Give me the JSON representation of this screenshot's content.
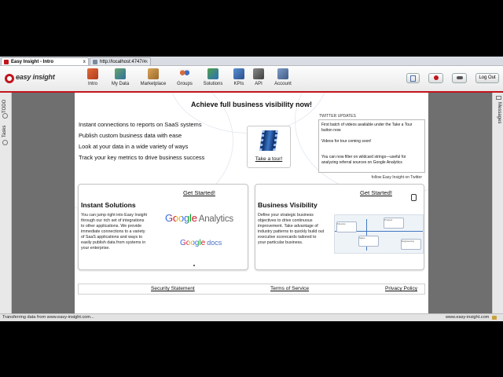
{
  "tabs": [
    {
      "label": "Easy Insight - Intro",
      "close": "x"
    },
    {
      "label": "http://localhost:4747/#",
      "close": "x"
    }
  ],
  "app": {
    "logo_text": "easy insight"
  },
  "nav": [
    {
      "label": "Intro",
      "icon": "home-icon"
    },
    {
      "label": "My Data",
      "icon": "data-icon"
    },
    {
      "label": "Marketplace",
      "icon": "marketplace-icon"
    },
    {
      "label": "Groups",
      "icon": "groups-icon"
    },
    {
      "label": "Solutions",
      "icon": "solutions-icon"
    },
    {
      "label": "KPIs",
      "icon": "kpi-icon"
    },
    {
      "label": "API",
      "icon": "api-icon"
    },
    {
      "label": "Account",
      "icon": "account-icon"
    }
  ],
  "toolbar": {
    "logout_label": "Log Out"
  },
  "sidebar_left": {
    "todo": "TODO",
    "tasks": "Tasks"
  },
  "sidebar_right": {
    "messages": "Messages"
  },
  "main": {
    "headline": "Achieve full business visibility now!",
    "features": [
      "Instant connections to reports on SaaS systems",
      "Publish custom business data with ease",
      "Look at your data in a wide variety of ways",
      "Track your key metrics to drive business success"
    ],
    "tour_link": "Take a tour!"
  },
  "twitter": {
    "title": "TWITTER UPDATES",
    "items": [
      "First batch of videos available under the Take a Tour button now",
      "Videos for tour coming soon!",
      "You can now filter on wildcard strings—useful for analyzing referral sources on Google Analytics"
    ],
    "follow": "follow Easy Insight on Twitter"
  },
  "cards": {
    "solutions": {
      "get_started": "Get Started!",
      "title": "Instant Solutions",
      "description": "You can jump right into Easy Insight through our rich set of integrations to other applications. We provide immediate connections to a variety of SaaS applications and ways to easily publish data from systems in your enterprise.",
      "google_analytics": {
        "google": "Google",
        "analytics": "Analytics"
      },
      "google_docs": {
        "google": "Google",
        "docs": "docs"
      }
    },
    "visibility": {
      "get_started": "Get Started!",
      "title": "Business Visibility",
      "description": "Define your strategic business objectives to drive continuous improvement. Take advantage of industry patterns to quickly build out executive scorecards tailored to your particular business.",
      "diagram_labels": [
        "Finance",
        "Product",
        "Sales",
        "Engineering"
      ]
    }
  },
  "footer": {
    "security": "Security Statement",
    "terms": "Terms of Service",
    "privacy": "Privacy Policy"
  },
  "status": {
    "left": "Transferring data from www.easy-insight.com...",
    "right": "www.easy-insight.com"
  },
  "colors": {
    "brand_red": "#c2151c",
    "gutter": "#6f6f6f"
  }
}
